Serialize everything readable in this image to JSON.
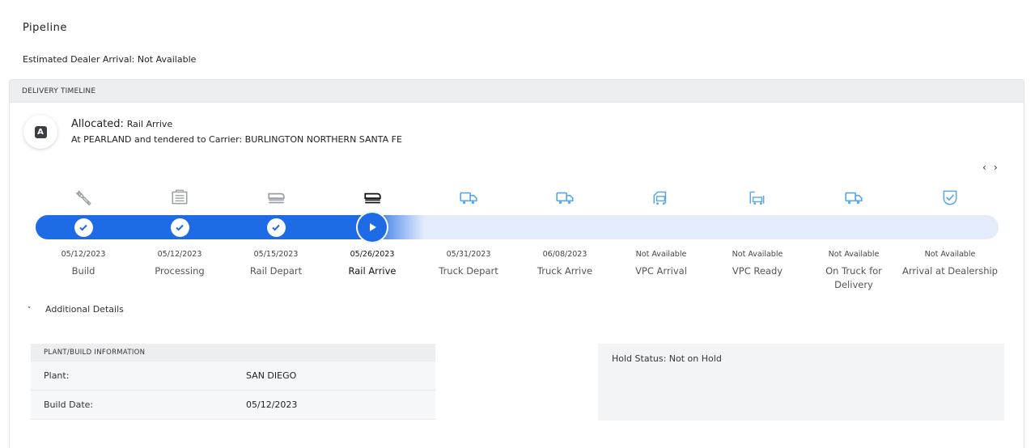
{
  "page": {
    "title": "Pipeline",
    "eta_label": "Estimated Dealer Arrival:",
    "eta_value": "Not Available"
  },
  "timeline": {
    "header": "DELIVERY TIMELINE",
    "status_badge": "A",
    "status_label": "Allocated:",
    "status_value": "Rail Arrive",
    "status_detail": "At PEARLAND and tendered to Carrier: BURLINGTON NORTHERN SANTA FE",
    "nav_prev": "‹",
    "nav_next": "›",
    "progress_fraction": 0.4,
    "accent_color": "#1e6be6",
    "steps": [
      {
        "label": "Build",
        "date": "05/12/2023",
        "state": "complete",
        "icon": "wrench-icon"
      },
      {
        "label": "Processing",
        "date": "05/12/2023",
        "state": "complete",
        "icon": "processing-icon"
      },
      {
        "label": "Rail Depart",
        "date": "05/15/2023",
        "state": "complete",
        "icon": "train-icon"
      },
      {
        "label": "Rail Arrive",
        "date": "05/26/2023",
        "state": "current",
        "icon": "train-icon"
      },
      {
        "label": "Truck Depart",
        "date": "05/31/2023",
        "state": "pending",
        "icon": "truck-icon"
      },
      {
        "label": "Truck Arrive",
        "date": "06/08/2023",
        "state": "pending",
        "icon": "truck-icon"
      },
      {
        "label": "VPC Arrival",
        "date": "Not Available",
        "state": "pending",
        "icon": "vpc-icon"
      },
      {
        "label": "VPC Ready",
        "date": "Not Available",
        "state": "pending",
        "icon": "vpc-ready-icon"
      },
      {
        "label": "On Truck for Delivery",
        "date": "Not Available",
        "state": "pending",
        "icon": "truck-icon"
      },
      {
        "label": "Arrival at Dealership",
        "date": "Not Available",
        "state": "pending",
        "icon": "shield-check-icon"
      }
    ]
  },
  "details": {
    "toggle_chevron": "˅",
    "toggle_label": "Additional Details",
    "plant_header": "PLANT/BUILD INFORMATION",
    "rows": [
      {
        "key": "Plant:",
        "value": "SAN DIEGO"
      },
      {
        "key": "Build Date:",
        "value": "05/12/2023"
      }
    ],
    "hold_status": "Hold Status: Not on Hold"
  }
}
